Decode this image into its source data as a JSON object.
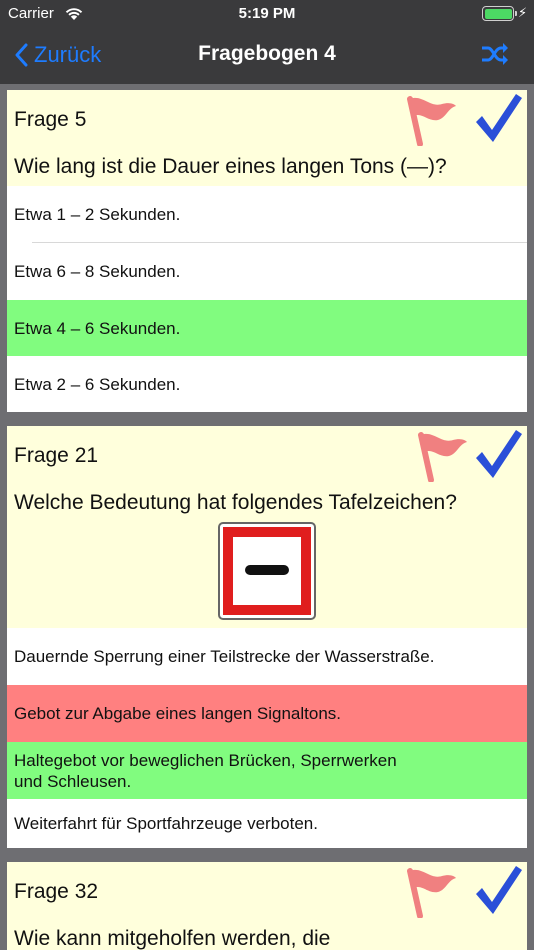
{
  "status": {
    "carrier": "Carrier",
    "time": "5:19 PM",
    "battery_level": 1.0
  },
  "nav": {
    "back_label": "Zurück",
    "title": "Fragebogen 4",
    "shuffle_icon": "shuffle-icon"
  },
  "questions": [
    {
      "number_label": "Frage 5",
      "text": "Wie lang ist die Dauer eines langen Tons (—)?",
      "answers": [
        {
          "text": "Etwa 1 – 2 Sekunden.",
          "state": "neutral"
        },
        {
          "text": "Etwa 6 – 8 Sekunden.",
          "state": "neutral"
        },
        {
          "text": "Etwa 4 – 6 Sekunden.",
          "state": "correct"
        },
        {
          "text": "Etwa 2 – 6 Sekunden.",
          "state": "neutral"
        }
      ]
    },
    {
      "number_label": "Frage 21",
      "text": "Welche Bedeutung hat folgendes Tafelzeichen?",
      "image": "sign-white-square-red-border-black-bar",
      "answers": [
        {
          "text": "Dauernde Sperrung einer Teilstrecke der Wasserstraße.",
          "state": "neutral"
        },
        {
          "text": "Gebot zur Abgabe eines langen Signaltons.",
          "state": "wrong"
        },
        {
          "text_line1": "Haltegebot vor beweglichen Brücken, Sperrwerken",
          "text_line2": "und Schleusen.",
          "state": "correct"
        },
        {
          "text": "Weiterfahrt für Sportfahrzeuge verboten.",
          "state": "neutral"
        }
      ]
    },
    {
      "number_label": "Frage 32",
      "text": "Wie kann mitgeholfen werden, die"
    }
  ],
  "colors": {
    "accent": "#1e7cff",
    "question_bg": "#ffffdc",
    "correct": "#81fc7f",
    "wrong": "#ff8080",
    "flag": "#f08080",
    "check": "#2a4fd8"
  }
}
